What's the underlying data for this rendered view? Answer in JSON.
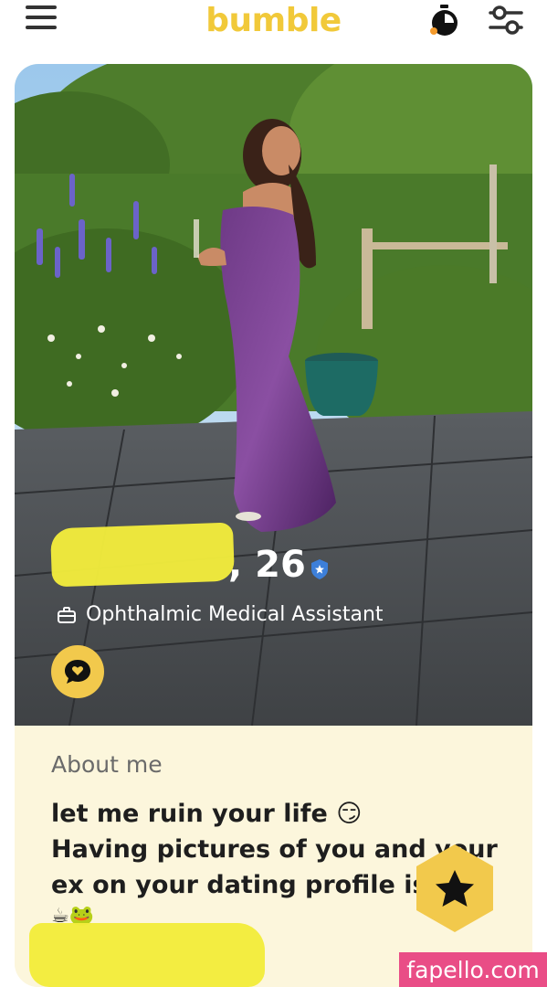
{
  "topbar": {
    "brand": "bumble",
    "icons": [
      "menu-icon",
      "timer-icon",
      "filter-icon"
    ],
    "brand_color": "#f1c93a"
  },
  "profile": {
    "age": ", 26",
    "verified_icon": "verified-badge-icon",
    "job": "Ophthalmic Medical Assistant",
    "chat_icon": "chat-heart-icon",
    "accent_color": "#f2c94c"
  },
  "about": {
    "title": "About me",
    "lines": [
      "let me ruin your life 😏",
      "Having pictures of you and your",
      "ex on your dating profile is"
    ],
    "emoji_line": "☕🐸"
  },
  "superswipe": {
    "icon": "star-icon"
  },
  "watermark": {
    "text": "fapello.com",
    "color": "#e94d86"
  }
}
